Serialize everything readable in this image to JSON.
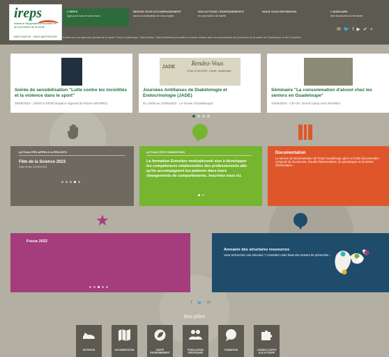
{
  "header": {
    "logo": {
      "word": "ireps",
      "sub": "Instance Régionale d'Éducation et de promotion de la santé",
      "line": "SAINT-MARTIN · SAINT-BARTHÉLEMY"
    },
    "nav": [
      {
        "title": "L'IREPS",
        "sub": "Agir pour tous et avec tous"
      },
      {
        "title": "BESOIN VOUS ACCOMPAGNEMENT",
        "sub": "dans la réalisation de vos projets"
      },
      {
        "title": "NOS ACTIONS / ENSEIGNEMENTS",
        "sub": "en promotion de santé"
      },
      {
        "title": "NOUS VOUS INFORMONS",
        "sub": ""
      },
      {
        "title": "L'ANNUAIRE",
        "sub": "des structures du territoire"
      }
    ],
    "tagline": "Invités sur une approche globale de la santé, l'Ireps Guadeloupe, Saint-Martin, Saint-Barthélemy travaille en étroite relation avec les associations de promotion de la santé de Guadeloupe et des Caraïbes.",
    "social": [
      "✉",
      "🐦",
      "f",
      "▶",
      "✔",
      "+"
    ]
  },
  "news": [
    {
      "title": "Soirée de sensibilisation \"Lutte contre les incivilités et la violence dans le sport\"",
      "meta": "09/05/2023 - 18h30 à 20h30 (Espace régional du Raizet ABYMES)"
    },
    {
      "title": "Journées Antillaises de Diabétologie et Endocrinologie (JADE)",
      "meta": "Du 10/06 au 12/06/2023 - Le Gosier (Guadeloupe)",
      "img_left": "JADE",
      "img_right": "Rendez-Vous",
      "img_date": "10 au 12 juin 2023 - Gosier, Guadeloupe"
    },
    {
      "title": "Séminaire \"La consommation d'alcool chez les séniors en Guadeloupe\"",
      "meta": "10/06/2023 - CR-GH, Grand Camp LES ABYMES"
    }
  ],
  "panels": {
    "grey": {
      "eyebrow": "ACTUALITÉS APPELS À PROJETS",
      "title": "Fête de la Science 2023",
      "text": "Date limite 20/06/2023"
    },
    "green": {
      "eyebrow": "ACTUALITÉS FORMATIONS",
      "title": "La formation Entretien motivationnel vise à développer les compétences relationnelles des professionnels afin qu'ils accompagnent les patients dans leurs changements de comportements. Inscrivez-vous ici."
    },
    "orange": {
      "title": "Documentation",
      "text": "Le service de documentation de l'Ireps Guadeloupe gère un fonds documentaire composé de documents, d'outils d'interventions, de périodiques et de lettres d'information..."
    },
    "purple": {
      "title": "Focus 2022"
    },
    "blue": {
      "title": "Annuaire des structures ressources",
      "text": "Vous recherchez une structure ? Consultez notre base des acteurs de prévention..."
    }
  },
  "foot_social": [
    "f",
    "🐦",
    "in"
  ],
  "poles_title": "Nos pôles",
  "poles": [
    {
      "label": "NUTRITION"
    },
    {
      "label": "DOCUMENTATION"
    },
    {
      "label": "SANTÉ ENVIRONNEMENT"
    },
    {
      "label": "POPULATIONS SPÉCIFIQUES"
    },
    {
      "label": "FORMATION"
    },
    {
      "label": "CONSEIL D'APPUI AUX ACTEURS"
    }
  ],
  "colors": {
    "green": "#76b52f",
    "dark_green": "#2e6b3c",
    "orange": "#e0562b",
    "purple": "#a53c7b",
    "blue": "#1f4c6b",
    "grey": "#6f6a60"
  }
}
